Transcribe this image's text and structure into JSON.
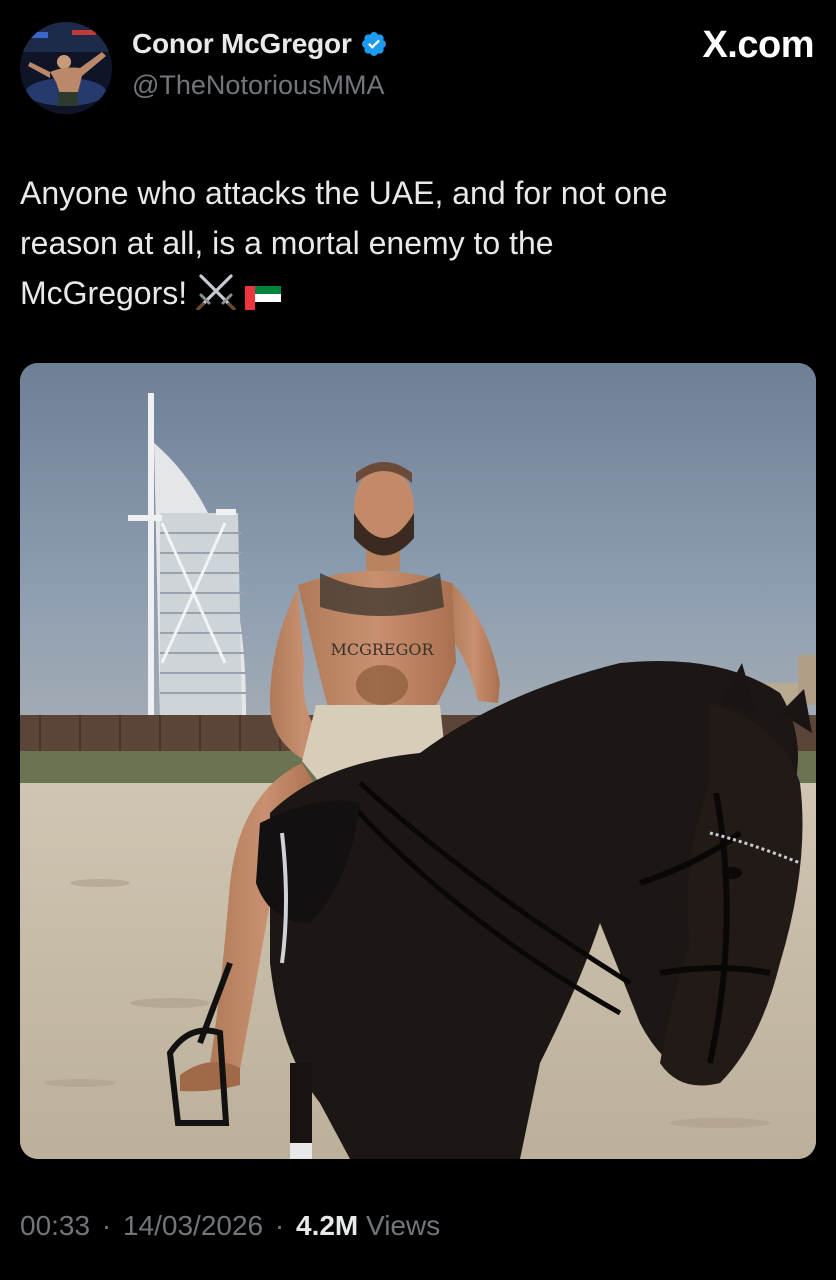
{
  "author": {
    "name": "Conor McGregor",
    "handle": "@TheNotoriousMMA",
    "verified": true,
    "avatar_icon": "avatar-photo"
  },
  "site": {
    "label": "X.com"
  },
  "tweet": {
    "lines": [
      "Anyone who attacks the UAE, and for not one",
      "reason at all, is a mortal enemy to the",
      "McGregors!"
    ],
    "emojis": [
      "crossed-swords-icon",
      "uae-flag-icon"
    ]
  },
  "media": {
    "tattoo_text": "MCGREGOR"
  },
  "meta": {
    "time": "00:33",
    "date": "14/03/2026",
    "views_count": "4.2M",
    "views_label": "Views",
    "separator": "·"
  },
  "colors": {
    "background": "#000000",
    "text_primary": "#e7e9ea",
    "text_secondary": "#71767b",
    "verified_blue": "#1d9bf0"
  }
}
